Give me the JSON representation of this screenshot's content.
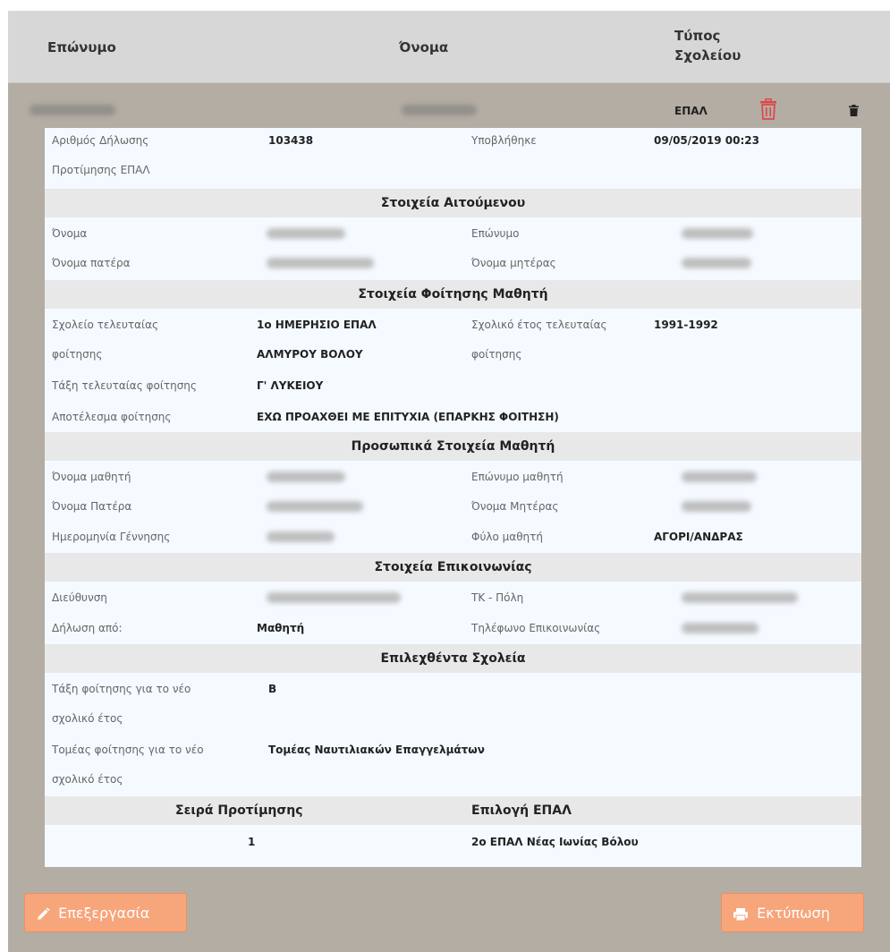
{
  "table_header": {
    "surname": "Επώνυμο",
    "name": "Όνομα",
    "school_type_line1": "Τύπος",
    "school_type_line2": "Σχολείου"
  },
  "summary": {
    "school_type": "ΕΠΑΛ"
  },
  "application": {
    "number_label_line1": "Αριθμός Δήλωσης",
    "number_label_line2": "Προτίμησης ΕΠΑΛ",
    "number_value": "103438",
    "submitted_label": "Υποβλήθηκε",
    "submitted_value": "09/05/2019 00:23"
  },
  "sections": {
    "applicant": "Στοιχεία Αιτούμενου",
    "attendance": "Στοιχεία Φοίτησης Μαθητή",
    "personal": "Προσωπικά Στοιχεία Μαθητή",
    "contact": "Στοιχεία Επικοινωνίας",
    "selected": "Επιλεχθέντα Σχολεία"
  },
  "applicant": {
    "name_label": "Όνομα",
    "surname_label": "Επώνυμο",
    "father_label": "Όνομα πατέρα",
    "mother_label": "Όνομα μητέρας"
  },
  "attendance": {
    "last_school_label_1": "Σχολείο τελευταίας",
    "last_school_label_2": "φοίτησης",
    "last_school_value_1": "1ο ΗΜΕΡΗΣΙΟ ΕΠΑΛ",
    "last_school_value_2": "ΑΛΜΥΡΟΥ ΒΟΛΟΥ",
    "last_year_label_1": "Σχολικό έτος τελευταίας",
    "last_year_label_2": "φοίτησης",
    "last_year_value": "1991-1992",
    "last_class_label": "Τάξη τελευταίας φοίτησης",
    "last_class_value": "Γ' ΛΥΚΕΙΟΥ",
    "result_label": "Αποτέλεσμα φοίτησης",
    "result_value": "ΕΧΩ ΠΡΟΑΧΘΕΙ ΜΕ ΕΠΙΤΥΧΙΑ (ΕΠΑΡΚΗΣ ΦΟΙΤΗΣΗ)"
  },
  "personal": {
    "student_name_label": "Όνομα μαθητή",
    "student_surname_label": "Επώνυμο μαθητή",
    "father_label": "Όνομα Πατέρα",
    "mother_label": "Όνομα Μητέρας",
    "birth_label": "Ημερομηνία Γέννησης",
    "gender_label": "Φύλο μαθητή",
    "gender_value": "ΑΓΟΡΙ/ΑΝΔΡΑΣ"
  },
  "contact": {
    "address_label": "Διεύθυνση",
    "postal_label": "ΤΚ - Πόλη",
    "declared_by_label": "Δήλωση από:",
    "declared_by_value": "Μαθητή",
    "phone_label": "Τηλέφωνο Επικοινωνίας"
  },
  "selected": {
    "class_label_1": "Τάξη φοίτησης για το νέο",
    "class_label_2": "σχολικό έτος",
    "class_value": "Β",
    "sector_label_1": "Τομέας φοίτησης για το νέο",
    "sector_label_2": "σχολικό έτος",
    "sector_value": "Τομέας Ναυτιλιακών Επαγγελμάτων"
  },
  "preferences": {
    "col_order": "Σειρά Προτίμησης",
    "col_choice": "Επιλογή ΕΠΑΛ",
    "rows": [
      {
        "order": "1",
        "choice": "2ο ΕΠΑΛ Νέας Ιωνίας Βόλου"
      }
    ]
  },
  "buttons": {
    "edit": "Επεξεργασία",
    "print": "Εκτύπωση"
  },
  "colors": {
    "accent": "#f7a57a",
    "delete": "#e04848",
    "page_bg": "#b3ada4",
    "panel_bg": "#f4faff"
  },
  "icons": {
    "edit": "pencil-icon",
    "print": "printer-icon",
    "delete": "trash-icon"
  }
}
